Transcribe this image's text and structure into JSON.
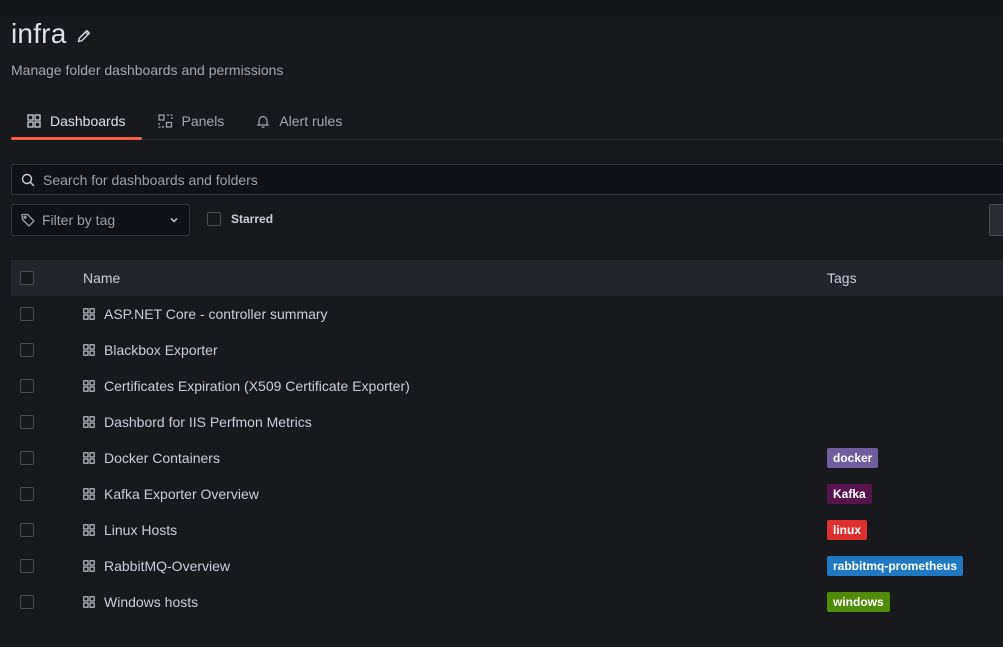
{
  "folder": {
    "title": "infra",
    "subtitle": "Manage folder dashboards and permissions"
  },
  "tabs": [
    {
      "label": "Dashboards",
      "icon": "apps-icon",
      "active": true
    },
    {
      "label": "Panels",
      "icon": "library-panels-icon",
      "active": false
    },
    {
      "label": "Alert rules",
      "icon": "bell-icon",
      "active": false
    }
  ],
  "search": {
    "placeholder": "Search for dashboards and folders",
    "value": ""
  },
  "filters": {
    "tag_placeholder": "Filter by tag",
    "starred_label": "Starred"
  },
  "table": {
    "columns": {
      "name": "Name",
      "tags": "Tags"
    },
    "rows": [
      {
        "name": "ASP.NET Core - controller summary",
        "tags": []
      },
      {
        "name": "Blackbox Exporter",
        "tags": []
      },
      {
        "name": "Certificates Expiration (X509 Certificate Exporter)",
        "tags": []
      },
      {
        "name": "Dashbord for IIS Perfmon Metrics",
        "tags": []
      },
      {
        "name": "Docker Containers",
        "tags": [
          {
            "label": "docker",
            "color": "#705da0"
          }
        ]
      },
      {
        "name": "Kafka Exporter Overview",
        "tags": [
          {
            "label": "Kafka",
            "color": "#58144c"
          }
        ]
      },
      {
        "name": "Linux Hosts",
        "tags": [
          {
            "label": "linux",
            "color": "#e02f2f"
          }
        ]
      },
      {
        "name": "RabbitMQ-Overview",
        "tags": [
          {
            "label": "rabbitmq-prometheus",
            "color": "#1f78c1"
          }
        ]
      },
      {
        "name": "Windows hosts",
        "tags": [
          {
            "label": "windows",
            "color": "#508c0a"
          }
        ]
      }
    ]
  },
  "colors": {
    "accent": "#f55f3e",
    "background": "#18191d"
  }
}
